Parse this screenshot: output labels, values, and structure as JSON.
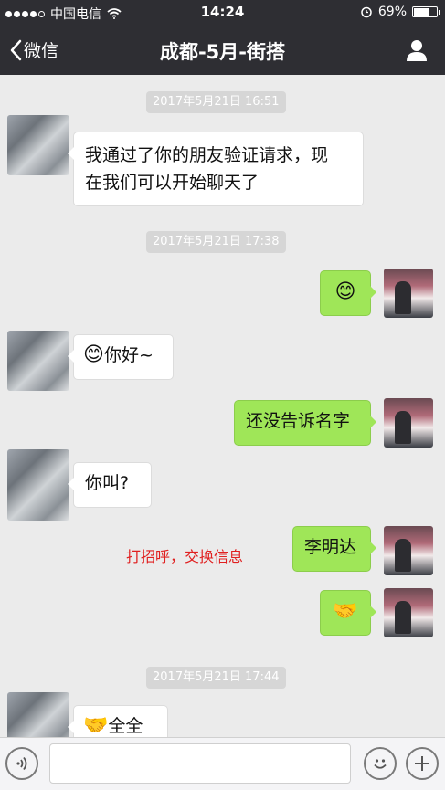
{
  "status_bar": {
    "carrier": "中国电信",
    "time": "14:24",
    "battery": "69%",
    "battery_level": 0.69
  },
  "nav": {
    "back_label": "微信",
    "title": "成都-5月-街搭"
  },
  "messages": [
    {
      "type": "timestamp",
      "text": "2017年5月21日 16:51"
    },
    {
      "type": "text",
      "from": "them",
      "lines": [
        "我通过了你的朋友验证请求，现",
        "在我们可以开始聊天了"
      ]
    },
    {
      "type": "timestamp",
      "text": "2017年5月21日 17:38"
    },
    {
      "type": "emoji",
      "from": "me",
      "emoji": "😊"
    },
    {
      "type": "text",
      "from": "them",
      "emoji": "😊",
      "text": "你好~"
    },
    {
      "type": "text",
      "from": "me",
      "text": "还没告诉名字"
    },
    {
      "type": "text",
      "from": "them",
      "text": "你叫?"
    },
    {
      "type": "text",
      "from": "me",
      "text": "李明达"
    },
    {
      "type": "emoji",
      "from": "me",
      "emoji": "🤝"
    },
    {
      "type": "timestamp",
      "text": "2017年5月21日 17:44"
    },
    {
      "type": "text",
      "from": "them",
      "emoji": "🤝",
      "text": "全全"
    }
  ],
  "annotation": "打招呼，交换信息",
  "input_bar": {
    "placeholder": ""
  }
}
